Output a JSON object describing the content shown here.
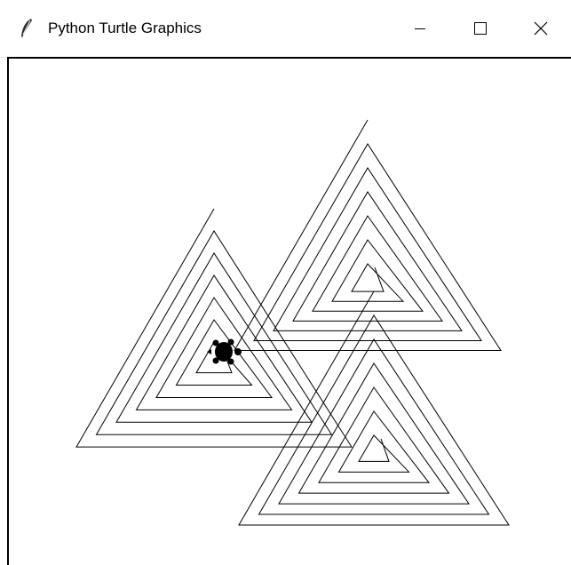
{
  "window": {
    "title": "Python Turtle Graphics",
    "icon": "feather-icon",
    "controls": {
      "minimize_icon": "minimize-icon",
      "maximize_icon": "maximize-icon",
      "close_icon": "close-icon"
    }
  },
  "canvas": {
    "background": "#ffffff",
    "pen_color": "#000000",
    "turtle_shape": "turtle",
    "turtle_color": "#000000",
    "drawing": "three nested triangular spirals"
  }
}
